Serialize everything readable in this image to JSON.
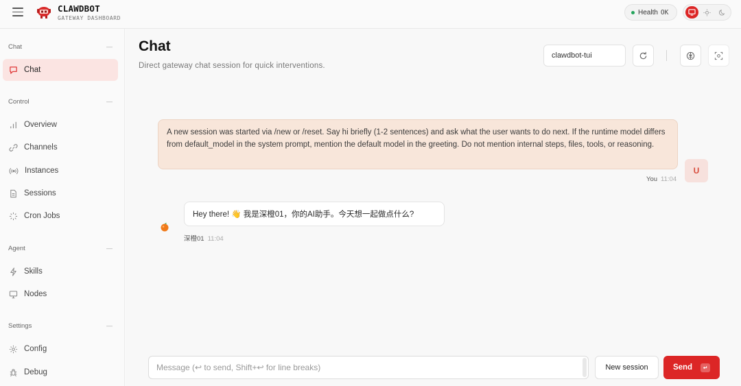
{
  "header": {
    "brand_name": "CLAWDBOT",
    "brand_sub": "GATEWAY DASHBOARD",
    "health_label": "Health",
    "health_status": "OK"
  },
  "sidebar": {
    "sections": [
      {
        "title": "Chat",
        "items": [
          {
            "label": "Chat",
            "icon": "message-icon",
            "active": true
          }
        ]
      },
      {
        "title": "Control",
        "items": [
          {
            "label": "Overview",
            "icon": "bar-chart-icon"
          },
          {
            "label": "Channels",
            "icon": "link-icon"
          },
          {
            "label": "Instances",
            "icon": "radio-icon"
          },
          {
            "label": "Sessions",
            "icon": "file-icon"
          },
          {
            "label": "Cron Jobs",
            "icon": "loader-icon"
          }
        ]
      },
      {
        "title": "Agent",
        "items": [
          {
            "label": "Skills",
            "icon": "zap-icon"
          },
          {
            "label": "Nodes",
            "icon": "monitor-icon"
          }
        ]
      },
      {
        "title": "Settings",
        "items": [
          {
            "label": "Config",
            "icon": "gear-icon"
          },
          {
            "label": "Debug",
            "icon": "bug-icon"
          }
        ]
      }
    ]
  },
  "page": {
    "title": "Chat",
    "subtitle": "Direct gateway chat session for quick interventions.",
    "session_value": "clawdbot-tui"
  },
  "messages": {
    "user": {
      "text": "A new session was started via /new or /reset. Say hi briefly (1-2 sentences) and ask what the user wants to do next. If the runtime model differs from default_model in the system prompt, mention the default model in the greeting. Do not mention internal steps, files, tools, or reasoning.",
      "avatar": "U",
      "sender": "You",
      "time": "11:04"
    },
    "bot": {
      "text": "Hey there! 👋 我是深橙01，你的AI助手。今天想一起做点什么?",
      "sender": "深橙01",
      "time": "11:04"
    }
  },
  "composer": {
    "placeholder": "Message (↩ to send, Shift+↩ for line breaks)",
    "new_session_label": "New session",
    "send_label": "Send",
    "send_kbd": "↵"
  },
  "colors": {
    "accent": "#dc2626",
    "user_bubble": "#f8e6da",
    "active_nav": "#fbe4e2"
  }
}
